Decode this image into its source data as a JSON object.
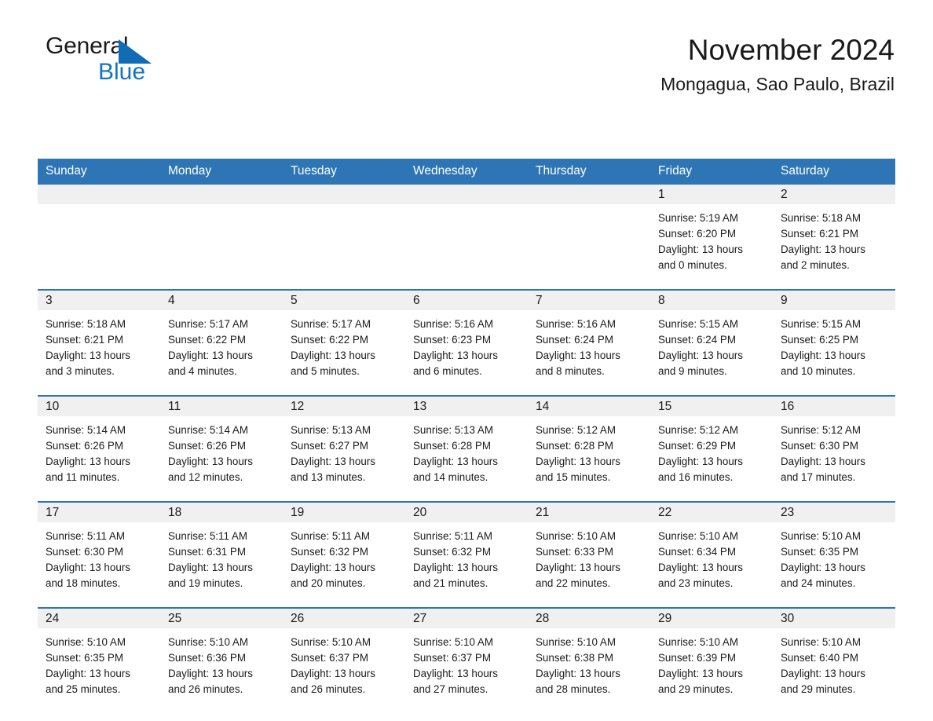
{
  "brand": {
    "name_part1": "General",
    "name_part2": "Blue",
    "accent_color": "#1275c4",
    "triangle_color": "#0f6cb5"
  },
  "header": {
    "month_title": "November 2024",
    "location": "Mongagua, Sao Paulo, Brazil"
  },
  "theme": {
    "header_blue": "#2e75b6",
    "date_band_gray": "#f0f0f0",
    "text_color": "#1a1a1a"
  },
  "day_headers": [
    "Sunday",
    "Monday",
    "Tuesday",
    "Wednesday",
    "Thursday",
    "Friday",
    "Saturday"
  ],
  "labels": {
    "sunrise_prefix": "Sunrise:",
    "sunset_prefix": "Sunset:",
    "daylight_prefix": "Daylight:"
  },
  "weeks": [
    [
      {
        "day": "",
        "blank": true
      },
      {
        "day": "",
        "blank": true
      },
      {
        "day": "",
        "blank": true
      },
      {
        "day": "",
        "blank": true
      },
      {
        "day": "",
        "blank": true
      },
      {
        "day": "1",
        "sunrise": "Sunrise: 5:19 AM",
        "sunset": "Sunset: 6:20 PM",
        "daylight_line1": "Daylight: 13 hours",
        "daylight_line2": "and 0 minutes."
      },
      {
        "day": "2",
        "sunrise": "Sunrise: 5:18 AM",
        "sunset": "Sunset: 6:21 PM",
        "daylight_line1": "Daylight: 13 hours",
        "daylight_line2": "and 2 minutes."
      }
    ],
    [
      {
        "day": "3",
        "sunrise": "Sunrise: 5:18 AM",
        "sunset": "Sunset: 6:21 PM",
        "daylight_line1": "Daylight: 13 hours",
        "daylight_line2": "and 3 minutes."
      },
      {
        "day": "4",
        "sunrise": "Sunrise: 5:17 AM",
        "sunset": "Sunset: 6:22 PM",
        "daylight_line1": "Daylight: 13 hours",
        "daylight_line2": "and 4 minutes."
      },
      {
        "day": "5",
        "sunrise": "Sunrise: 5:17 AM",
        "sunset": "Sunset: 6:22 PM",
        "daylight_line1": "Daylight: 13 hours",
        "daylight_line2": "and 5 minutes."
      },
      {
        "day": "6",
        "sunrise": "Sunrise: 5:16 AM",
        "sunset": "Sunset: 6:23 PM",
        "daylight_line1": "Daylight: 13 hours",
        "daylight_line2": "and 6 minutes."
      },
      {
        "day": "7",
        "sunrise": "Sunrise: 5:16 AM",
        "sunset": "Sunset: 6:24 PM",
        "daylight_line1": "Daylight: 13 hours",
        "daylight_line2": "and 8 minutes."
      },
      {
        "day": "8",
        "sunrise": "Sunrise: 5:15 AM",
        "sunset": "Sunset: 6:24 PM",
        "daylight_line1": "Daylight: 13 hours",
        "daylight_line2": "and 9 minutes."
      },
      {
        "day": "9",
        "sunrise": "Sunrise: 5:15 AM",
        "sunset": "Sunset: 6:25 PM",
        "daylight_line1": "Daylight: 13 hours",
        "daylight_line2": "and 10 minutes."
      }
    ],
    [
      {
        "day": "10",
        "sunrise": "Sunrise: 5:14 AM",
        "sunset": "Sunset: 6:26 PM",
        "daylight_line1": "Daylight: 13 hours",
        "daylight_line2": "and 11 minutes."
      },
      {
        "day": "11",
        "sunrise": "Sunrise: 5:14 AM",
        "sunset": "Sunset: 6:26 PM",
        "daylight_line1": "Daylight: 13 hours",
        "daylight_line2": "and 12 minutes."
      },
      {
        "day": "12",
        "sunrise": "Sunrise: 5:13 AM",
        "sunset": "Sunset: 6:27 PM",
        "daylight_line1": "Daylight: 13 hours",
        "daylight_line2": "and 13 minutes."
      },
      {
        "day": "13",
        "sunrise": "Sunrise: 5:13 AM",
        "sunset": "Sunset: 6:28 PM",
        "daylight_line1": "Daylight: 13 hours",
        "daylight_line2": "and 14 minutes."
      },
      {
        "day": "14",
        "sunrise": "Sunrise: 5:12 AM",
        "sunset": "Sunset: 6:28 PM",
        "daylight_line1": "Daylight: 13 hours",
        "daylight_line2": "and 15 minutes."
      },
      {
        "day": "15",
        "sunrise": "Sunrise: 5:12 AM",
        "sunset": "Sunset: 6:29 PM",
        "daylight_line1": "Daylight: 13 hours",
        "daylight_line2": "and 16 minutes."
      },
      {
        "day": "16",
        "sunrise": "Sunrise: 5:12 AM",
        "sunset": "Sunset: 6:30 PM",
        "daylight_line1": "Daylight: 13 hours",
        "daylight_line2": "and 17 minutes."
      }
    ],
    [
      {
        "day": "17",
        "sunrise": "Sunrise: 5:11 AM",
        "sunset": "Sunset: 6:30 PM",
        "daylight_line1": "Daylight: 13 hours",
        "daylight_line2": "and 18 minutes."
      },
      {
        "day": "18",
        "sunrise": "Sunrise: 5:11 AM",
        "sunset": "Sunset: 6:31 PM",
        "daylight_line1": "Daylight: 13 hours",
        "daylight_line2": "and 19 minutes."
      },
      {
        "day": "19",
        "sunrise": "Sunrise: 5:11 AM",
        "sunset": "Sunset: 6:32 PM",
        "daylight_line1": "Daylight: 13 hours",
        "daylight_line2": "and 20 minutes."
      },
      {
        "day": "20",
        "sunrise": "Sunrise: 5:11 AM",
        "sunset": "Sunset: 6:32 PM",
        "daylight_line1": "Daylight: 13 hours",
        "daylight_line2": "and 21 minutes."
      },
      {
        "day": "21",
        "sunrise": "Sunrise: 5:10 AM",
        "sunset": "Sunset: 6:33 PM",
        "daylight_line1": "Daylight: 13 hours",
        "daylight_line2": "and 22 minutes."
      },
      {
        "day": "22",
        "sunrise": "Sunrise: 5:10 AM",
        "sunset": "Sunset: 6:34 PM",
        "daylight_line1": "Daylight: 13 hours",
        "daylight_line2": "and 23 minutes."
      },
      {
        "day": "23",
        "sunrise": "Sunrise: 5:10 AM",
        "sunset": "Sunset: 6:35 PM",
        "daylight_line1": "Daylight: 13 hours",
        "daylight_line2": "and 24 minutes."
      }
    ],
    [
      {
        "day": "24",
        "sunrise": "Sunrise: 5:10 AM",
        "sunset": "Sunset: 6:35 PM",
        "daylight_line1": "Daylight: 13 hours",
        "daylight_line2": "and 25 minutes."
      },
      {
        "day": "25",
        "sunrise": "Sunrise: 5:10 AM",
        "sunset": "Sunset: 6:36 PM",
        "daylight_line1": "Daylight: 13 hours",
        "daylight_line2": "and 26 minutes."
      },
      {
        "day": "26",
        "sunrise": "Sunrise: 5:10 AM",
        "sunset": "Sunset: 6:37 PM",
        "daylight_line1": "Daylight: 13 hours",
        "daylight_line2": "and 26 minutes."
      },
      {
        "day": "27",
        "sunrise": "Sunrise: 5:10 AM",
        "sunset": "Sunset: 6:37 PM",
        "daylight_line1": "Daylight: 13 hours",
        "daylight_line2": "and 27 minutes."
      },
      {
        "day": "28",
        "sunrise": "Sunrise: 5:10 AM",
        "sunset": "Sunset: 6:38 PM",
        "daylight_line1": "Daylight: 13 hours",
        "daylight_line2": "and 28 minutes."
      },
      {
        "day": "29",
        "sunrise": "Sunrise: 5:10 AM",
        "sunset": "Sunset: 6:39 PM",
        "daylight_line1": "Daylight: 13 hours",
        "daylight_line2": "and 29 minutes."
      },
      {
        "day": "30",
        "sunrise": "Sunrise: 5:10 AM",
        "sunset": "Sunset: 6:40 PM",
        "daylight_line1": "Daylight: 13 hours",
        "daylight_line2": "and 29 minutes."
      }
    ]
  ]
}
